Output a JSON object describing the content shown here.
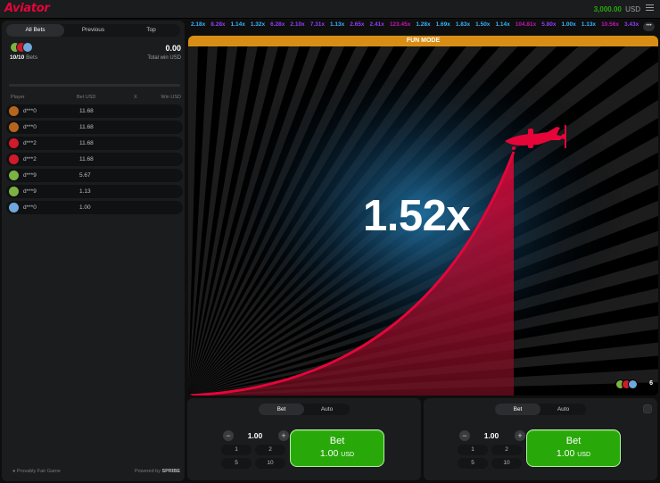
{
  "header": {
    "logo_text": "Aviator",
    "balance": "3,000.00",
    "currency": "USD",
    "menu_icon": "hamburger-menu-icon"
  },
  "left_panel": {
    "tabs": [
      {
        "label": "All Bets",
        "active": true
      },
      {
        "label": "Previous",
        "active": false
      },
      {
        "label": "Top",
        "active": false
      }
    ],
    "bets_count": "10/10",
    "bets_label": "Bets",
    "total_win_value": "0.00",
    "total_win_label": "Total win USD",
    "columns": {
      "player": "Player",
      "bet": "Bet USD",
      "x": "X",
      "win": "Win USD"
    },
    "rows": [
      {
        "name": "d***0",
        "bet": "11.68",
        "avatar_color": "#b5651d"
      },
      {
        "name": "d***0",
        "bet": "11.68",
        "avatar_color": "#b5651d"
      },
      {
        "name": "d***2",
        "bet": "11.68",
        "avatar_color": "#d11a2a"
      },
      {
        "name": "d***2",
        "bet": "11.68",
        "avatar_color": "#d11a2a"
      },
      {
        "name": "d***9",
        "bet": "5.67",
        "avatar_color": "#7cb342"
      },
      {
        "name": "d***9",
        "bet": "1.13",
        "avatar_color": "#7cb342"
      },
      {
        "name": "d***0",
        "bet": "1.00",
        "avatar_color": "#6fa8dc"
      }
    ],
    "footer": {
      "provably_fair": "Provably Fair Game",
      "powered_by": "Powered by",
      "brand": "SPRIBE"
    }
  },
  "history": [
    {
      "v": "2.18x",
      "c": "blue"
    },
    {
      "v": "8.28x",
      "c": "purple"
    },
    {
      "v": "1.14x",
      "c": "blue"
    },
    {
      "v": "1.32x",
      "c": "blue"
    },
    {
      "v": "6.28x",
      "c": "purple"
    },
    {
      "v": "2.10x",
      "c": "purple"
    },
    {
      "v": "7.31x",
      "c": "purple"
    },
    {
      "v": "1.13x",
      "c": "blue"
    },
    {
      "v": "2.65x",
      "c": "purple"
    },
    {
      "v": "2.41x",
      "c": "purple"
    },
    {
      "v": "123.45x",
      "c": "pink"
    },
    {
      "v": "1.28x",
      "c": "blue"
    },
    {
      "v": "1.69x",
      "c": "blue"
    },
    {
      "v": "1.83x",
      "c": "blue"
    },
    {
      "v": "1.50x",
      "c": "blue"
    },
    {
      "v": "1.14x",
      "c": "blue"
    },
    {
      "v": "104.81x",
      "c": "pink"
    },
    {
      "v": "5.80x",
      "c": "purple"
    },
    {
      "v": "1.00x",
      "c": "blue"
    },
    {
      "v": "1.13x",
      "c": "blue"
    },
    {
      "v": "10.56x",
      "c": "pink"
    },
    {
      "v": "3.43x",
      "c": "purple"
    }
  ],
  "history_more": "•••",
  "game": {
    "mode_banner": "FUN MODE",
    "multiplier": "1.52x",
    "online_players": "6",
    "colors": {
      "curve": "#e50539",
      "banner": "#d88e16"
    }
  },
  "bet_panels": [
    {
      "tabs": [
        {
          "label": "Bet",
          "active": true
        },
        {
          "label": "Auto",
          "active": false
        }
      ],
      "stake": "1.00",
      "quick": [
        "1",
        "2",
        "5",
        "10"
      ],
      "button_label": "Bet",
      "button_amount": "1.00",
      "button_currency": "USD"
    },
    {
      "tabs": [
        {
          "label": "Bet",
          "active": true
        },
        {
          "label": "Auto",
          "active": false
        }
      ],
      "stake": "1.00",
      "quick": [
        "1",
        "2",
        "5",
        "10"
      ],
      "button_label": "Bet",
      "button_amount": "1.00",
      "button_currency": "USD"
    }
  ]
}
